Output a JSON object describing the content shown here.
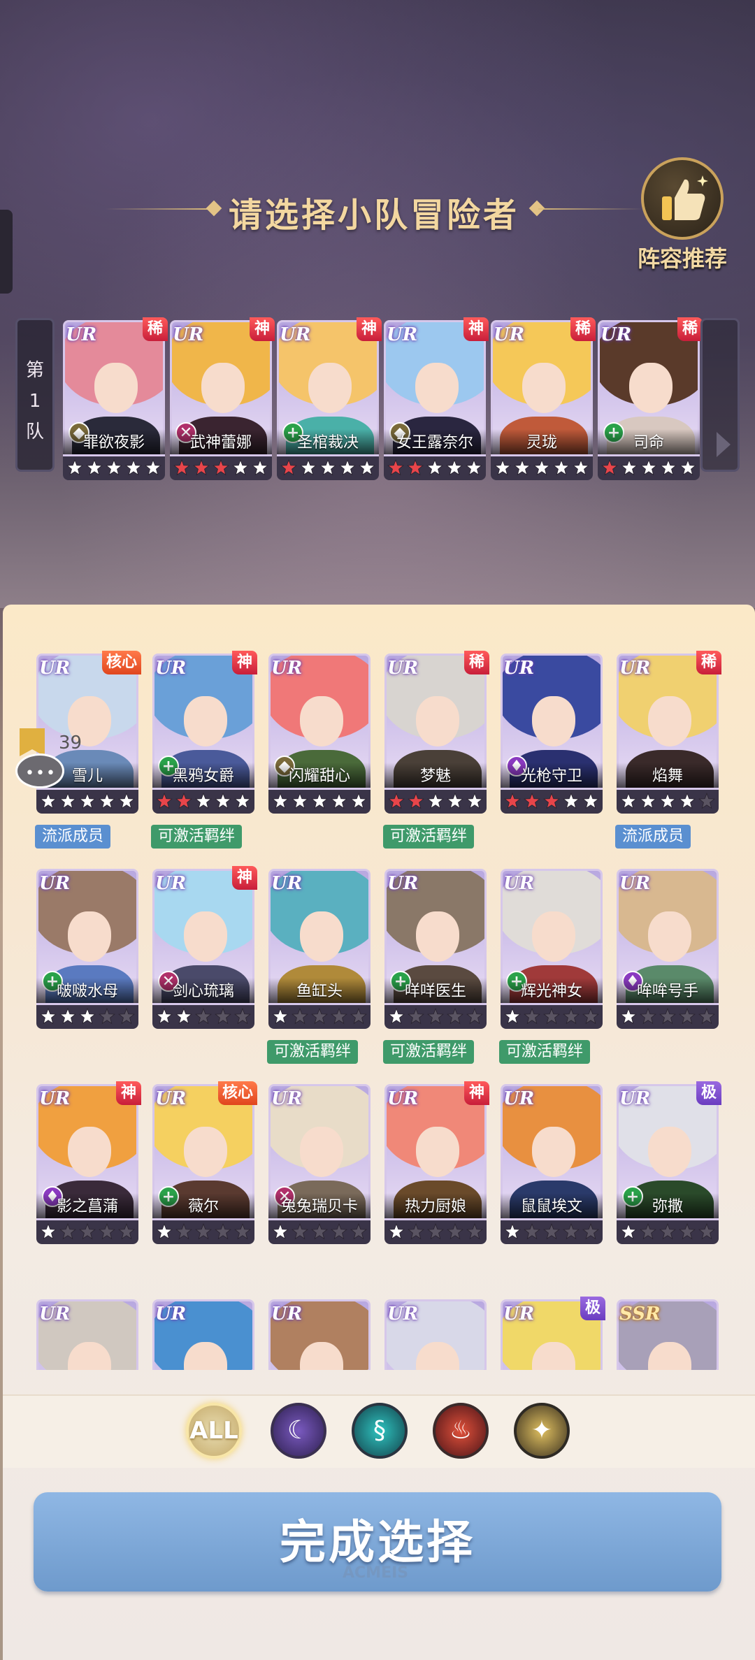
{
  "header": {
    "title": "请选择小队冒险者",
    "lineup_button_label": "阵容推荐"
  },
  "team": {
    "label_line1": "第",
    "label_line2": "1",
    "label_line3": "队",
    "members": [
      {
        "name": "罪欲夜影",
        "rarity": "UR",
        "badge": "稀",
        "class": "tank",
        "red_stars": 0,
        "white_stars": 5,
        "hair": "#e48a9a",
        "outfit": "#2a2a3a"
      },
      {
        "name": "武神蕾娜",
        "rarity": "UR",
        "badge": "神",
        "class": "dps",
        "red_stars": 3,
        "white_stars": 2,
        "hair": "#f0b64a",
        "outfit": "#3a2430"
      },
      {
        "name": "圣棺裁决",
        "rarity": "UR",
        "badge": "神",
        "class": "heal",
        "red_stars": 1,
        "white_stars": 4,
        "hair": "#f5c46a",
        "outfit": "#4ab0a8"
      },
      {
        "name": "女王露奈尔",
        "rarity": "UR",
        "badge": "神",
        "class": "tank",
        "red_stars": 2,
        "white_stars": 3,
        "hair": "#9cc8ef",
        "outfit": "#2a2640"
      },
      {
        "name": "灵珑",
        "rarity": "UR",
        "badge": "稀",
        "class": "none",
        "red_stars": 0,
        "white_stars": 5,
        "hair": "#f5c858",
        "outfit": "#c05a3a"
      },
      {
        "name": "司命",
        "rarity": "UR",
        "badge": "稀",
        "class": "heal",
        "red_stars": 1,
        "white_stars": 4,
        "hair": "#5a3a2a",
        "outfit": "#d8c8c0"
      }
    ]
  },
  "roster": [
    {
      "name": "雪儿",
      "rarity": "UR",
      "badge": "核心",
      "badge_type": "core",
      "class": "none",
      "red_stars": 0,
      "white_stars": 5,
      "total": 5,
      "hair": "#c8d8ec",
      "outfit": "#6a8ab8",
      "tag": "流派成员",
      "tag_type": "school"
    },
    {
      "name": "黑鸦女爵",
      "rarity": "UR",
      "badge": "神",
      "badge_type": "god",
      "class": "heal",
      "red_stars": 2,
      "white_stars": 3,
      "total": 5,
      "hair": "#6aa0d8",
      "outfit": "#4a5a9a",
      "tag": "可激活羁绊",
      "tag_type": "bond"
    },
    {
      "name": "闪耀甜心",
      "rarity": "UR",
      "badge": "",
      "badge_type": "",
      "class": "tank",
      "red_stars": 0,
      "white_stars": 5,
      "total": 5,
      "hair": "#f07878",
      "outfit": "#4a6a3a",
      "tag": "",
      "tag_type": ""
    },
    {
      "name": "梦魅",
      "rarity": "UR",
      "badge": "稀",
      "badge_type": "",
      "class": "none",
      "red_stars": 2,
      "white_stars": 3,
      "total": 5,
      "hair": "#d8d4d0",
      "outfit": "#4a4038",
      "tag": "可激活羁绊",
      "tag_type": "bond"
    },
    {
      "name": "光枪守卫",
      "rarity": "UR",
      "badge": "",
      "badge_type": "",
      "class": "mage",
      "red_stars": 3,
      "white_stars": 2,
      "total": 5,
      "hair": "#3a4aa0",
      "outfit": "#2a3070",
      "tag": "",
      "tag_type": ""
    },
    {
      "name": "焰舞",
      "rarity": "UR",
      "badge": "稀",
      "badge_type": "",
      "class": "none",
      "red_stars": 0,
      "white_stars": 4,
      "total": 5,
      "hair": "#f0d070",
      "outfit": "#3a2a2a",
      "tag": "流派成员",
      "tag_type": "school"
    },
    {
      "name": "啵啵水母",
      "rarity": "UR",
      "badge": "",
      "badge_type": "",
      "class": "heal",
      "red_stars": 0,
      "white_stars": 3,
      "total": 5,
      "hair": "#9a7a68",
      "outfit": "#5a7ac0",
      "tag": "",
      "tag_type": ""
    },
    {
      "name": "剑心琉璃",
      "rarity": "UR",
      "badge": "神",
      "badge_type": "god",
      "class": "dps",
      "red_stars": 0,
      "white_stars": 2,
      "total": 5,
      "hair": "#a8d8f0",
      "outfit": "#4a4a6a",
      "tag": "",
      "tag_type": ""
    },
    {
      "name": "鱼缸头",
      "rarity": "UR",
      "badge": "",
      "badge_type": "",
      "class": "none",
      "red_stars": 0,
      "white_stars": 1,
      "total": 5,
      "hair": "#5ab0c0",
      "outfit": "#b08a3a",
      "tag": "可激活羁绊",
      "tag_type": "bond"
    },
    {
      "name": "咩咩医生",
      "rarity": "UR",
      "badge": "",
      "badge_type": "",
      "class": "heal",
      "red_stars": 0,
      "white_stars": 1,
      "total": 5,
      "hair": "#8a7868",
      "outfit": "#5a4a40",
      "tag": "可激活羁绊",
      "tag_type": "bond"
    },
    {
      "name": "辉光神女",
      "rarity": "UR",
      "badge": "",
      "badge_type": "",
      "class": "heal",
      "red_stars": 0,
      "white_stars": 1,
      "total": 5,
      "hair": "#e0dcd8",
      "outfit": "#a03a3a",
      "tag": "可激活羁绊",
      "tag_type": "bond"
    },
    {
      "name": "哞哞号手",
      "rarity": "UR",
      "badge": "",
      "badge_type": "",
      "class": "mage",
      "red_stars": 0,
      "white_stars": 1,
      "total": 5,
      "hair": "#d8b890",
      "outfit": "#5a8a6a",
      "tag": "",
      "tag_type": ""
    },
    {
      "name": "影之菖蒲",
      "rarity": "UR",
      "badge": "神",
      "badge_type": "god",
      "class": "mage",
      "red_stars": 0,
      "white_stars": 1,
      "total": 5,
      "hair": "#f0a040",
      "outfit": "#3a2a3a",
      "tag": "",
      "tag_type": ""
    },
    {
      "name": "薇尔",
      "rarity": "UR",
      "badge": "核心",
      "badge_type": "core",
      "class": "heal",
      "red_stars": 0,
      "white_stars": 1,
      "total": 5,
      "hair": "#f5d060",
      "outfit": "#5a3a30",
      "tag": "",
      "tag_type": ""
    },
    {
      "name": "兔兔瑞贝卡",
      "rarity": "UR",
      "badge": "",
      "badge_type": "",
      "class": "dps",
      "red_stars": 0,
      "white_stars": 1,
      "total": 5,
      "hair": "#e8dcc8",
      "outfit": "#7a6a5a",
      "tag": "",
      "tag_type": ""
    },
    {
      "name": "热力厨娘",
      "rarity": "UR",
      "badge": "神",
      "badge_type": "god",
      "class": "none",
      "red_stars": 0,
      "white_stars": 1,
      "total": 5,
      "hair": "#f08878",
      "outfit": "#6a4a2a",
      "tag": "",
      "tag_type": ""
    },
    {
      "name": "鼠鼠埃文",
      "rarity": "UR",
      "badge": "",
      "badge_type": "",
      "class": "none",
      "red_stars": 0,
      "white_stars": 1,
      "total": 5,
      "hair": "#e89040",
      "outfit": "#2a3a6a",
      "tag": "",
      "tag_type": ""
    },
    {
      "name": "弥撒",
      "rarity": "UR",
      "badge": "极",
      "badge_type": "ext",
      "class": "heal",
      "red_stars": 0,
      "white_stars": 1,
      "total": 5,
      "hair": "#e0e0e8",
      "outfit": "#2a4a2a",
      "tag": "",
      "tag_type": ""
    },
    {
      "name": "",
      "rarity": "UR",
      "badge": "",
      "badge_type": "",
      "class": "none",
      "red_stars": 0,
      "white_stars": 0,
      "total": 0,
      "hair": "#d0c8c0",
      "outfit": "#a03a3a",
      "tag": "",
      "tag_type": ""
    },
    {
      "name": "",
      "rarity": "UR",
      "badge": "",
      "badge_type": "",
      "class": "none",
      "red_stars": 0,
      "white_stars": 0,
      "total": 0,
      "hair": "#4a90d0",
      "outfit": "#2a4a7a",
      "tag": "",
      "tag_type": ""
    },
    {
      "name": "",
      "rarity": "UR",
      "badge": "",
      "badge_type": "",
      "class": "none",
      "red_stars": 0,
      "white_stars": 0,
      "total": 0,
      "hair": "#b08060",
      "outfit": "#5a5a70",
      "tag": "",
      "tag_type": ""
    },
    {
      "name": "",
      "rarity": "UR",
      "badge": "",
      "badge_type": "",
      "class": "none",
      "red_stars": 0,
      "white_stars": 0,
      "total": 0,
      "hair": "#d8d8e8",
      "outfit": "#3a3a50",
      "tag": "",
      "tag_type": ""
    },
    {
      "name": "",
      "rarity": "UR",
      "badge": "极",
      "badge_type": "ext",
      "class": "none",
      "red_stars": 0,
      "white_stars": 0,
      "total": 0,
      "hair": "#f0d868",
      "outfit": "#6a5a8a",
      "tag": "",
      "tag_type": ""
    },
    {
      "name": "",
      "rarity": "SSR",
      "badge": "",
      "badge_type": "",
      "class": "none",
      "red_stars": 0,
      "white_stars": 0,
      "total": 0,
      "hair": "#a8a0b8",
      "outfit": "#2a2a3a",
      "tag": "",
      "tag_type": ""
    }
  ],
  "floating_widget": {
    "count": "39"
  },
  "filters": {
    "all_label": "ALL",
    "icons": [
      "moon-element-icon",
      "wind-element-icon",
      "fire-element-icon",
      "light-element-icon"
    ]
  },
  "done_button_label": "完成选择",
  "watermark": "ACMEIS",
  "colors": {
    "accent_gold": "#f3d7a0",
    "button_blue": "#7ea8d8",
    "bond_green": "#3f9a6a",
    "school_blue": "#5a8fd0"
  }
}
